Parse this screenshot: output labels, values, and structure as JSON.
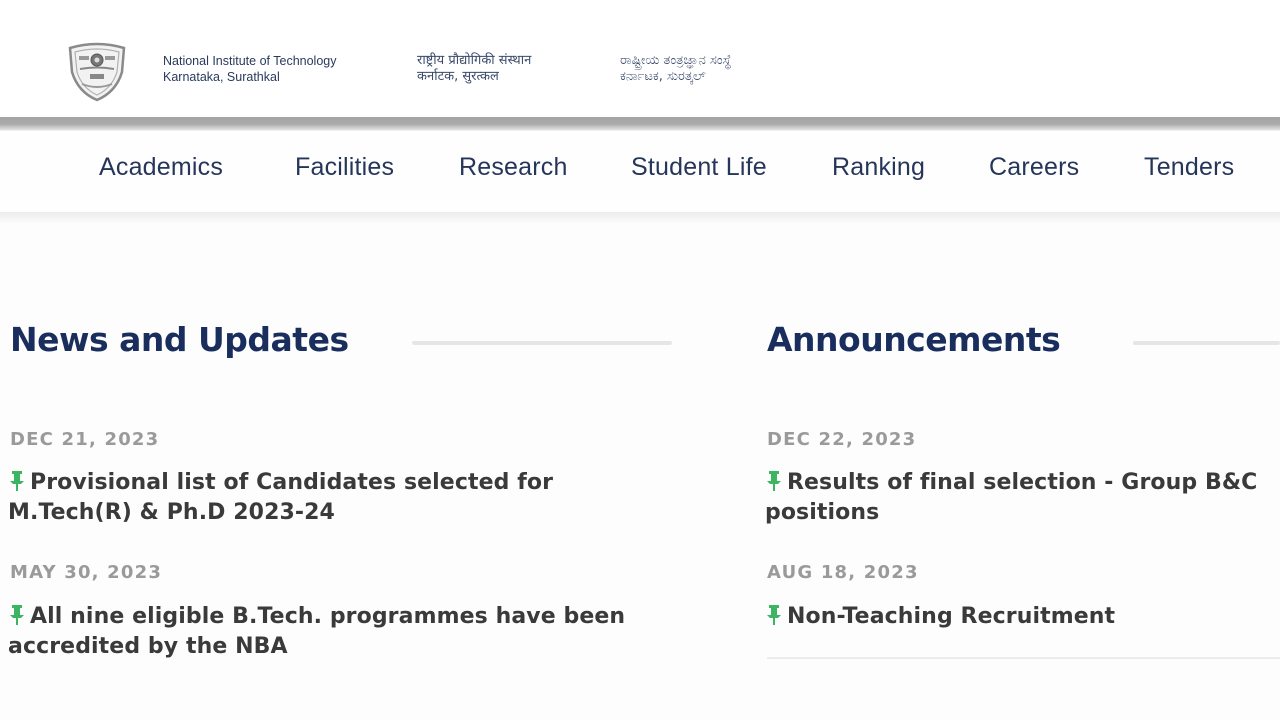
{
  "header": {
    "institute_name_en_line1": "National Institute of Technology",
    "institute_name_en_line2": "Karnataka, Surathkal",
    "institute_name_hi_line1": "राष्ट्रीय प्रौद्योगिकी संस्थान",
    "institute_name_hi_line2": "कर्नाटक, सुरत्कल",
    "institute_name_kn_line1": "ರಾಷ್ಟ್ರೀಯ ತಂತ್ರಜ್ಞಾನ ಸಂಸ್ಥೆ",
    "institute_name_kn_line2": "ಕರ್ನಾಟಕ, ಸುರತ್ಕಲ್",
    "logo_icon": "nitk-crest-logo"
  },
  "nav": {
    "items": [
      {
        "label": "Academics"
      },
      {
        "label": "Facilities"
      },
      {
        "label": "Research"
      },
      {
        "label": "Student Life"
      },
      {
        "label": "Ranking"
      },
      {
        "label": "Careers"
      },
      {
        "label": "Tenders"
      }
    ]
  },
  "news": {
    "title": "News and Updates",
    "items": [
      {
        "date": "DEC 21, 2023",
        "icon": "pushpin-icon",
        "line1": "Provisional list of Candidates selected for",
        "line2": "M.Tech(R) & Ph.D 2023-24"
      },
      {
        "date": "MAY 30, 2023",
        "icon": "pushpin-icon",
        "line1": "All nine eligible B.Tech. programmes have been",
        "line2": "accredited by the NBA"
      }
    ]
  },
  "announcements": {
    "title": "Announcements",
    "items": [
      {
        "date": "DEC 22, 2023",
        "icon": "pushpin-icon",
        "line1": "Results of final selection - Group B&C",
        "line2": "positions"
      },
      {
        "date": "AUG 18, 2023",
        "icon": "pushpin-icon",
        "line1": "Non-Teaching Recruitment",
        "line2": ""
      }
    ]
  },
  "colors": {
    "heading": "#1a2e5e",
    "nav_text": "#26355a",
    "date_text": "#9a9a9a",
    "pin_green": "#3cb563",
    "body_text": "#3a3a3a"
  }
}
